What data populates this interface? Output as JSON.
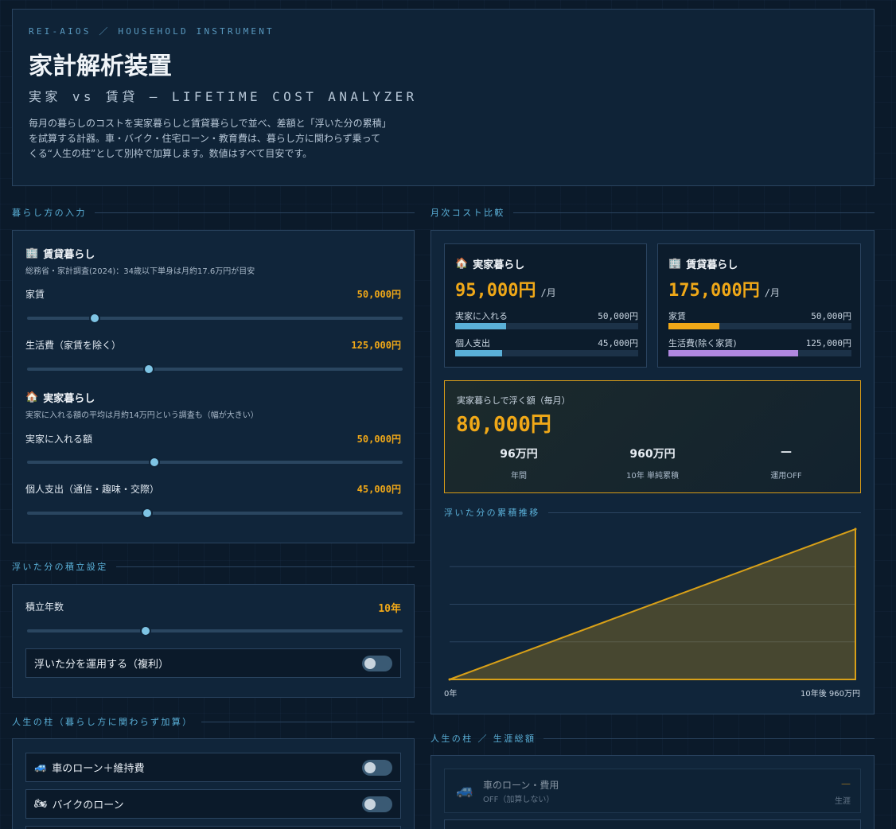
{
  "header": {
    "breadcrumb": "REI-AIOS ／ HOUSEHOLD INSTRUMENT",
    "title": "家計解析装置",
    "subtitle": "実家 vs 賃貸 — LIFETIME COST ANALYZER",
    "description": "毎月の暮らしのコストを実家暮らしと賃貸暮らしで並べ、差額と「浮いた分の累積」を試算する計器。車・バイク・住宅ローン・教育費は、暮らし方に関わらず乗ってくる“人生の柱”として別枠で加算します。数値はすべて目安です。"
  },
  "input_section": {
    "heading": "暮らし方の入力",
    "rent": {
      "icon": "building-icon",
      "title": "賃貸暮らし",
      "note": "総務省・家計調査(2024)：34歳以下単身は月約17.6万円が目安",
      "fields": [
        {
          "label": "家賃",
          "value": "50,000円",
          "level": 0.18
        },
        {
          "label": "生活費（家賃を除く）",
          "value": "125,000円",
          "level": 0.325
        }
      ]
    },
    "home": {
      "icon": "house-icon",
      "title": "実家暮らし",
      "note": "実家に入れる額の平均は月約14万円という調査も（幅が大きい）",
      "fields": [
        {
          "label": "実家に入れる額",
          "value": "50,000円",
          "level": 0.34
        },
        {
          "label": "個人支出（通信・趣味・交際）",
          "value": "45,000円",
          "level": 0.32
        }
      ]
    }
  },
  "savings_settings": {
    "heading": "浮いた分の積立設定",
    "years_label": "積立年数",
    "years_value": "10年",
    "years_level": 0.315,
    "compound_label": "浮いた分を運用する（複利）"
  },
  "pillars": {
    "heading": "人生の柱（暮らし方に関わらず加算）",
    "items": [
      {
        "icon": "car-icon",
        "glyph": "🚙",
        "label": "車のローン＋維持費"
      },
      {
        "icon": "motorcycle-icon",
        "glyph": "🏍",
        "label": "バイクのローン"
      }
    ]
  },
  "comparison": {
    "heading": "月次コスト比較",
    "unit": "/月",
    "home": {
      "title": "実家暮らし",
      "total": "95,000円",
      "rows": [
        {
          "label": "実家に入れる",
          "value": "50,000円",
          "share": 0.28,
          "color": "#5ab0d8"
        },
        {
          "label": "個人支出",
          "value": "45,000円",
          "share": 0.255,
          "color": "#5ab0d8"
        }
      ]
    },
    "rent": {
      "title": "賃貸暮らし",
      "total": "175,000円",
      "rows": [
        {
          "label": "家賃",
          "value": "50,000円",
          "share": 0.28,
          "color": "#f0a818"
        },
        {
          "label": "生活費(除く家賃)",
          "value": "125,000円",
          "share": 0.71,
          "color": "#b088e0"
        }
      ]
    },
    "savings": {
      "label": "実家暮らしで浮く額（毎月）",
      "amount": "80,000円",
      "stats": [
        {
          "value": "96万円",
          "label": "年間"
        },
        {
          "value": "960万円",
          "label": "10年 単純累積"
        },
        {
          "value": "—",
          "label": "運用OFF"
        }
      ]
    }
  },
  "chart_data": {
    "type": "area",
    "title": "浮いた分の累積推移",
    "x_labels": [
      "0年",
      "10年後 960万円"
    ],
    "x": [
      0,
      10
    ],
    "values": [
      0,
      960
    ],
    "ylim": [
      0,
      960
    ],
    "grid": true,
    "fill_color": "#d8a018"
  },
  "lifetime": {
    "heading": "人生の柱 ／ 生涯総額",
    "items": [
      {
        "icon": "car-icon",
        "glyph": "🚙",
        "title": "車のローン・費用",
        "sub": "OFF（加算しない）",
        "value": "—",
        "unit": "生涯"
      }
    ]
  }
}
